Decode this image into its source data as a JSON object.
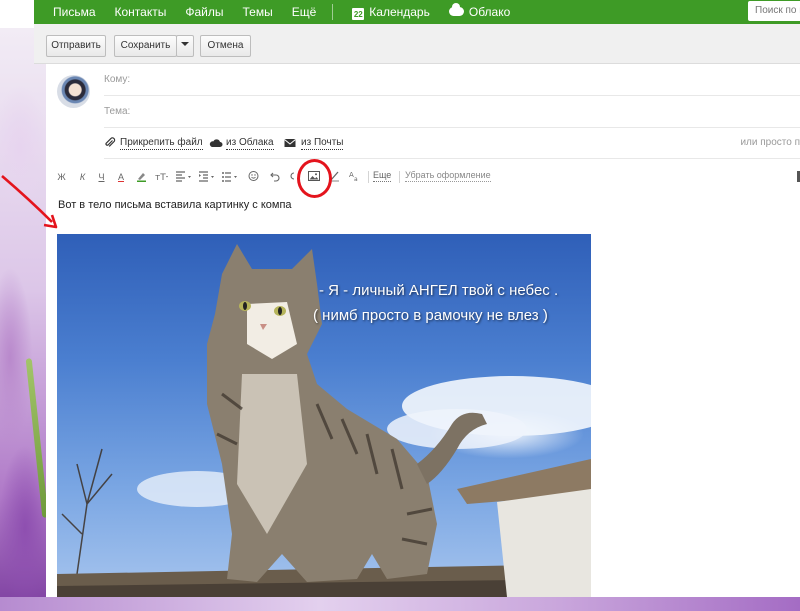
{
  "nav": {
    "items": [
      "Письма",
      "Контакты",
      "Файлы",
      "Темы",
      "Ещё"
    ],
    "calendar_icon_text": "22",
    "calendar": "Календарь",
    "cloud": "Облако",
    "search_placeholder": "Поиск по п"
  },
  "actions": {
    "send": "Отправить",
    "save": "Сохранить",
    "cancel": "Отмена"
  },
  "compose": {
    "to_label": "Кому:",
    "subject_label": "Тема:",
    "attach_file": "Прикрепить файл",
    "from_cloud": "из Облака",
    "from_mail": "из Почты",
    "attach_hint": "или просто п"
  },
  "format_toolbar": {
    "bold": "Ж",
    "italic": "К",
    "underline": "Ч",
    "text_color": "А",
    "more": "Еще",
    "clear_format": "Убрать оформление"
  },
  "body": {
    "text": "Вот в тело письма вставила картинку с компа",
    "image_caption_line1": "- Я - личный АНГЕЛ твой с небес .",
    "image_caption_line2": "( нимб просто в рамочку не влез )"
  },
  "colors": {
    "nav_green": "#3e9b26",
    "annotation_red": "#e4141d"
  }
}
